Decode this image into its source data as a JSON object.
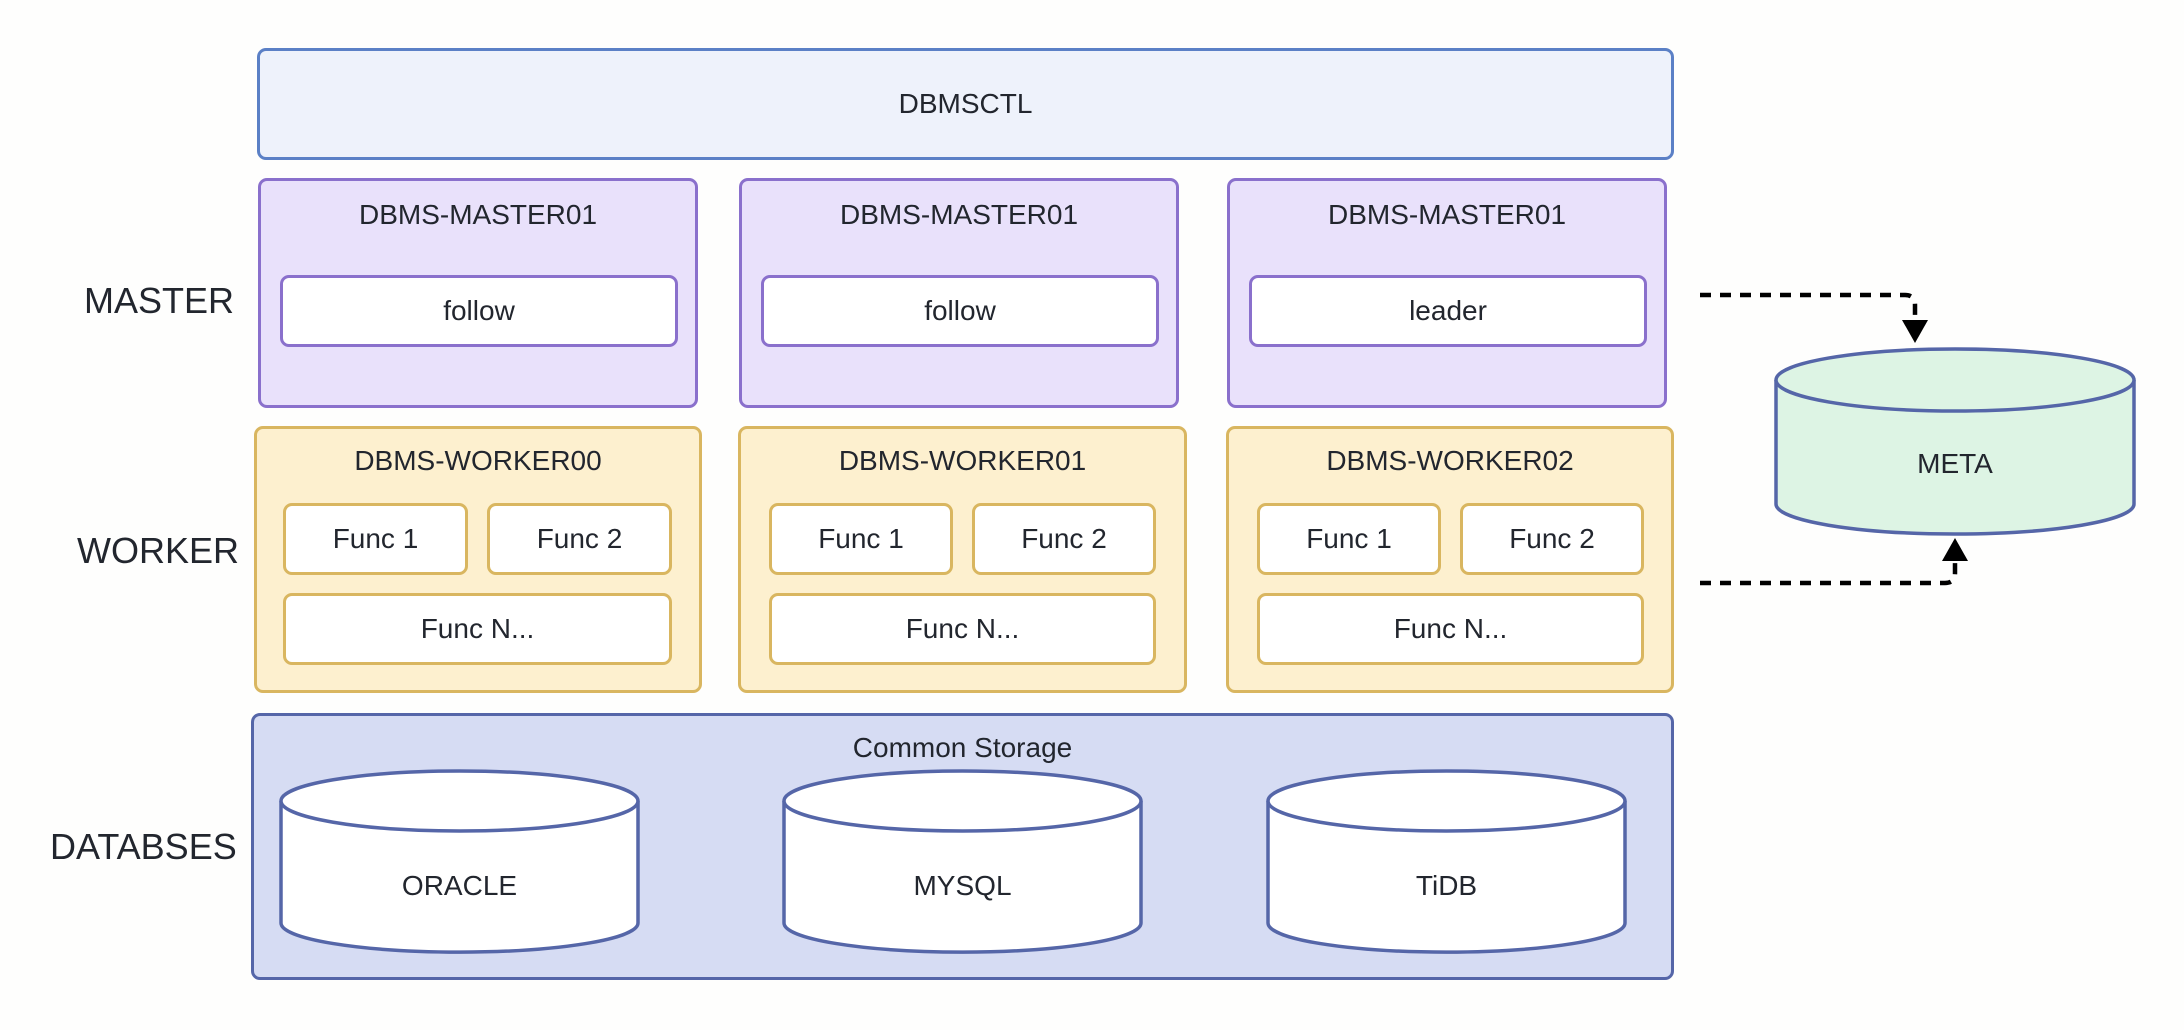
{
  "controller": {
    "label": "DBMSCTL"
  },
  "layers": {
    "master": "MASTER",
    "worker": "WORKER",
    "databases": "DATABSES"
  },
  "masters": [
    {
      "name": "DBMS-MASTER01",
      "role": "follow"
    },
    {
      "name": "DBMS-MASTER01",
      "role": "follow"
    },
    {
      "name": "DBMS-MASTER01",
      "role": "leader"
    }
  ],
  "workers": [
    {
      "name": "DBMS-WORKER00",
      "funcs": [
        "Func 1",
        "Func 2",
        "Func N..."
      ]
    },
    {
      "name": "DBMS-WORKER01",
      "funcs": [
        "Func 1",
        "Func 2",
        "Func N..."
      ]
    },
    {
      "name": "DBMS-WORKER02",
      "funcs": [
        "Func 1",
        "Func 2",
        "Func N..."
      ]
    }
  ],
  "storage": {
    "title": "Common Storage",
    "databases": [
      "ORACLE",
      "MYSQL",
      "TiDB"
    ]
  },
  "meta": {
    "label": "META"
  },
  "connections": [
    {
      "from": "master-leader",
      "to": "meta",
      "style": "dashed",
      "arrow": "end"
    },
    {
      "from": "workers",
      "to": "meta",
      "style": "dashed",
      "arrow": "end"
    }
  ],
  "colors": {
    "controller_fill": "#eef2fb",
    "controller_border": "#5b80c6",
    "master_fill": "#e9e1fb",
    "master_border": "#8a70cc",
    "worker_fill": "#fdf0cf",
    "worker_border": "#d9b660",
    "storage_fill": "#d6dcf3",
    "storage_border": "#5566a8",
    "meta_fill": "#ddf4e4",
    "text": "#22262e"
  }
}
